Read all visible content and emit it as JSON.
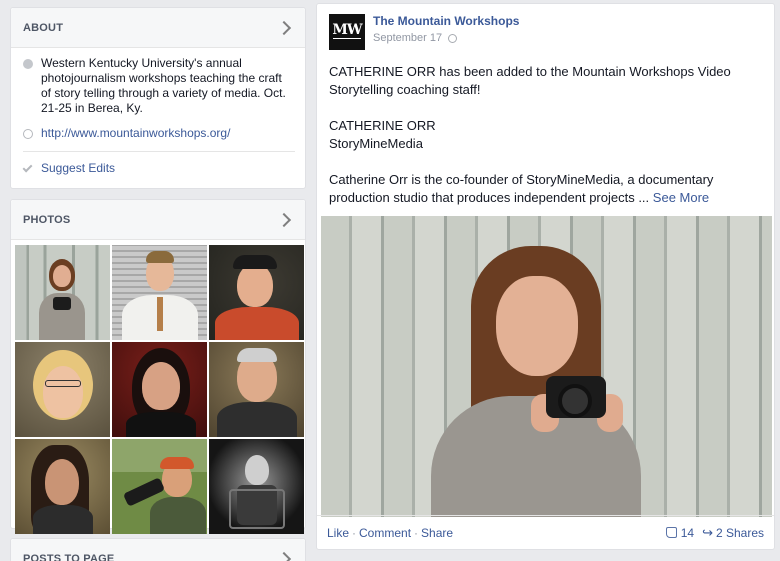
{
  "about": {
    "title": "ABOUT",
    "description": "Western Kentucky University's annual photojournalism workshops teaching the craft of story telling through a variety of media. Oct. 21-25 in Berea, Ky.",
    "website": "http://www.mountainworkshops.org/",
    "suggest_edits": "Suggest Edits"
  },
  "photos": {
    "title": "PHOTOS"
  },
  "posts_to_page": {
    "title": "POSTS TO PAGE"
  },
  "post": {
    "page_name": "The Mountain Workshops",
    "date": "September 17",
    "logo_letters": "MW",
    "paragraph1": "CATHERINE ORR has been added to the Mountain Workshops Video Storytelling coaching staff!",
    "name_line": "CATHERINE ORR",
    "org_line": "StoryMineMedia",
    "paragraph3": "Catherine Orr is the co-founder of StoryMineMedia, a documentary production studio that produces independent projects ...",
    "see_more": "See More",
    "actions": {
      "like": "Like",
      "comment": "Comment",
      "share": "Share",
      "separator": "·"
    },
    "likes_count": "14",
    "shares_label": "2 Shares"
  }
}
